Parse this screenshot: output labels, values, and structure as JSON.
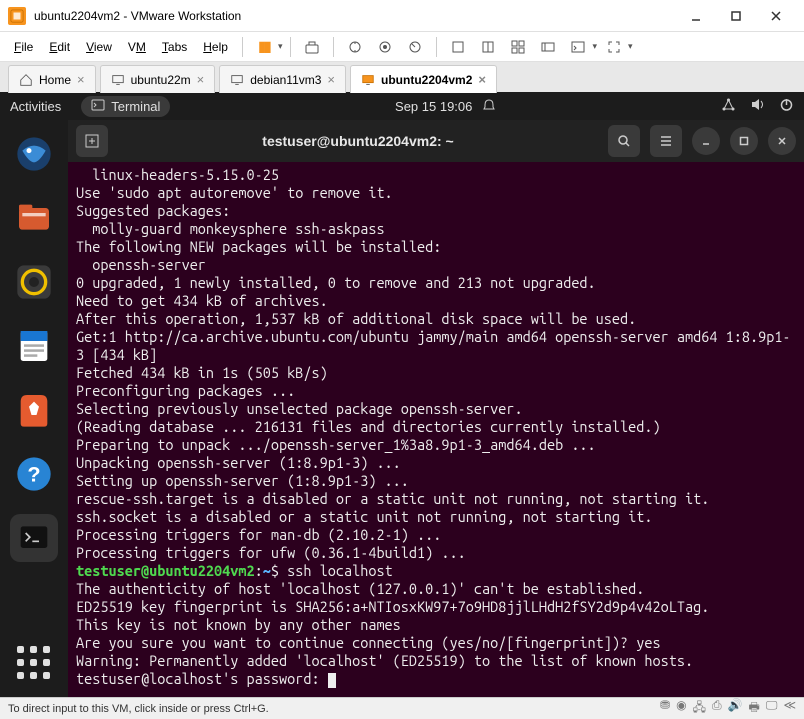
{
  "vmware": {
    "window_title": "ubuntu2204vm2 - VMware Workstation",
    "menu": {
      "file": "File",
      "edit": "Edit",
      "view": "View",
      "vm": "VM",
      "tabs": "Tabs",
      "help": "Help"
    },
    "tabs": [
      {
        "label": "Home",
        "active": false
      },
      {
        "label": "ubuntu22m",
        "active": false
      },
      {
        "label": "debian11vm3",
        "active": false
      },
      {
        "label": "ubuntu2204vm2",
        "active": true
      }
    ],
    "status_hint": "To direct input to this VM, click inside or press Ctrl+G."
  },
  "gnome": {
    "activities": "Activities",
    "app_name": "Terminal",
    "clock": "Sep 15  19:06"
  },
  "terminal": {
    "title": "testuser@ubuntu2204vm2: ~",
    "prompt_user": "testuser@ubuntu2204vm2",
    "prompt_path": "~",
    "prompt_cmd": "ssh localhost",
    "lines": [
      "  linux-headers-5.15.0-25",
      "Use 'sudo apt autoremove' to remove it.",
      "Suggested packages:",
      "  molly-guard monkeysphere ssh-askpass",
      "The following NEW packages will be installed:",
      "  openssh-server",
      "0 upgraded, 1 newly installed, 0 to remove and 213 not upgraded.",
      "Need to get 434 kB of archives.",
      "After this operation, 1,537 kB of additional disk space will be used.",
      "Get:1 http://ca.archive.ubuntu.com/ubuntu jammy/main amd64 openssh-server amd64 1:8.9p1-3 [434 kB]",
      "Fetched 434 kB in 1s (505 kB/s)",
      "Preconfiguring packages ...",
      "Selecting previously unselected package openssh-server.",
      "(Reading database ... 216131 files and directories currently installed.)",
      "Preparing to unpack .../openssh-server_1%3a8.9p1-3_amd64.deb ...",
      "Unpacking openssh-server (1:8.9p1-3) ...",
      "Setting up openssh-server (1:8.9p1-3) ...",
      "rescue-ssh.target is a disabled or a static unit not running, not starting it.",
      "ssh.socket is a disabled or a static unit not running, not starting it.",
      "Processing triggers for man-db (2.10.2-1) ...",
      "Processing triggers for ufw (0.36.1-4build1) ..."
    ],
    "post_lines": [
      "The authenticity of host 'localhost (127.0.0.1)' can't be established.",
      "ED25519 key fingerprint is SHA256:a+NTIosxKW97+7o9HD8jjlLHdH2fSY2d9p4v42oLTag.",
      "This key is not known by any other names",
      "Are you sure you want to continue connecting (yes/no/[fingerprint])? yes",
      "Warning: Permanently added 'localhost' (ED25519) to the list of known hosts.",
      "testuser@localhost's password: "
    ]
  }
}
